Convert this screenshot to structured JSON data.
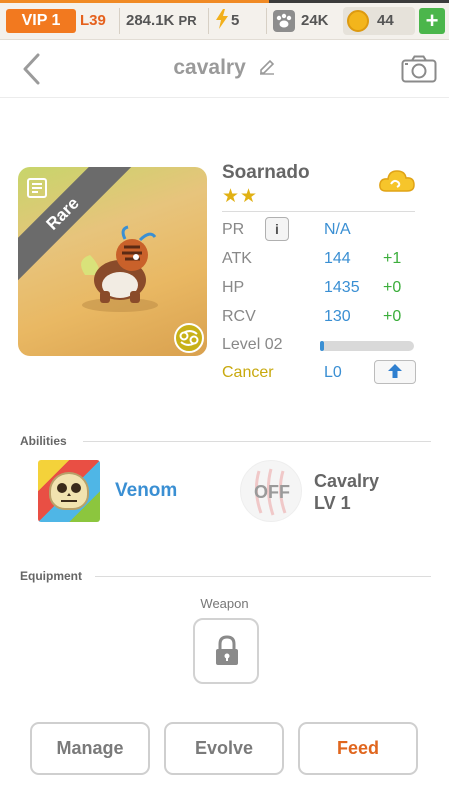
{
  "topbar": {
    "energy_bar_progress": 0.6,
    "vip_label": "VIP 1",
    "level": "L39",
    "power": "284.1K",
    "power_unit": "PR",
    "energy": "5",
    "food": "24K",
    "coins": "44",
    "add_label": "+"
  },
  "header": {
    "title": "cavalry"
  },
  "monster": {
    "rarity": "Rare",
    "name": "Soarnado",
    "stars": "★★",
    "stats": {
      "pr_label": "PR",
      "pr_value": "N/A",
      "atk_label": "ATK",
      "atk_value": "144",
      "atk_bonus": "+1",
      "hp_label": "HP",
      "hp_value": "1435",
      "hp_bonus": "+0",
      "rcv_label": "RCV",
      "rcv_value": "130",
      "rcv_bonus": "+0",
      "level_label": "Level 02",
      "level_progress": 0.02,
      "element_label": "Cancer",
      "element_level": "L0"
    }
  },
  "abilities": {
    "section_title": "Abilities",
    "ability_name": "Venom",
    "skill_state": "OFF",
    "skill_name": "Cavalry",
    "skill_level": "LV 1"
  },
  "equipment": {
    "section_title": "Equipment",
    "weapon_label": "Weapon"
  },
  "actions": {
    "manage": "Manage",
    "evolve": "Evolve",
    "feed": "Feed"
  },
  "colors": {
    "accent_orange": "#f2791f",
    "stat_blue": "#3a8fd3",
    "bonus_green": "#3cae3c",
    "zodiac_gold": "#c8a90e"
  }
}
